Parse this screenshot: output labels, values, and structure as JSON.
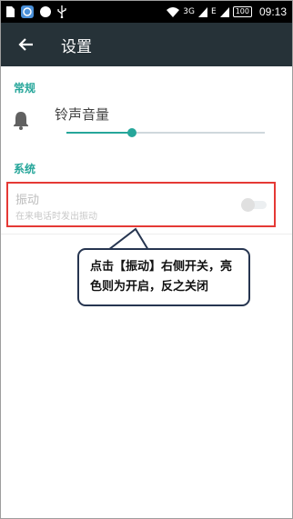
{
  "status_bar": {
    "time": "09:13",
    "battery": "100",
    "network_label": "3G",
    "network_label_2": "E"
  },
  "app_bar": {
    "back_icon": "arrow-back-icon",
    "title": "设置"
  },
  "sections": {
    "general": "常规",
    "system": "系统"
  },
  "ringtone": {
    "label": "铃声音量",
    "icon": "bell-icon",
    "level": 0.33
  },
  "vibrate": {
    "title": "振动",
    "subtitle": "在来电话时发出振动",
    "enabled": false
  },
  "callout": {
    "text_line1": "点击【振动】右侧开关，亮",
    "text_line2": "色则为开启，反之关闭"
  },
  "colors": {
    "app_bar": "#263238",
    "accent": "#26a69a",
    "highlight_border": "#e53935",
    "callout_border": "#263550"
  }
}
